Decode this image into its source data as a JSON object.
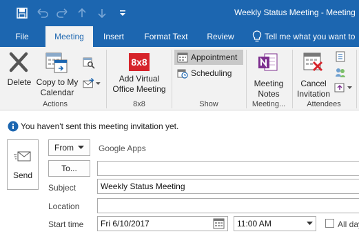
{
  "window": {
    "title": "Weekly Status Meeting - Meeting"
  },
  "tabs": [
    {
      "label": "File"
    },
    {
      "label": "Meeting"
    },
    {
      "label": "Insert"
    },
    {
      "label": "Format Text"
    },
    {
      "label": "Review"
    }
  ],
  "tell_me": {
    "label": "Tell me what you want to"
  },
  "ribbon": {
    "actions": {
      "delete_label": "Delete",
      "copy_label_1": "Copy to My",
      "copy_label_2": "Calendar",
      "group_label": "Actions"
    },
    "eightx8": {
      "logo_text": "8x8",
      "button_label_1": "Add Virtual",
      "button_label_2": "Office Meeting",
      "group_label": "8x8"
    },
    "show": {
      "appointment_label": "Appointment",
      "scheduling_label": "Scheduling",
      "group_label": "Show"
    },
    "meeting_notes": {
      "label_1": "Meeting",
      "label_2": "Notes",
      "group_label": "Meeting..."
    },
    "attendees": {
      "cancel_label_1": "Cancel",
      "cancel_label_2": "Invitation",
      "group_label": "Attendees"
    }
  },
  "info_bar": {
    "message": "You haven't sent this meeting invitation yet."
  },
  "form": {
    "send_label": "Send",
    "from_label": "From",
    "from_value": "Google Apps",
    "to_label": "To...",
    "to_value": "",
    "subject_label": "Subject",
    "subject_value": "Weekly Status Meeting",
    "location_label": "Location",
    "location_value": "",
    "start_time_label": "Start time",
    "start_date_value": "Fri 6/10/2017",
    "start_time_value": "11:00 AM",
    "all_day_label": "All day"
  },
  "colors": {
    "accent": "#1c66b0",
    "ribbon_bg": "#f2f2f2",
    "logo_red": "#d6242b",
    "onenote_purple": "#7d2f8f",
    "info_blue": "#1c66b0"
  }
}
